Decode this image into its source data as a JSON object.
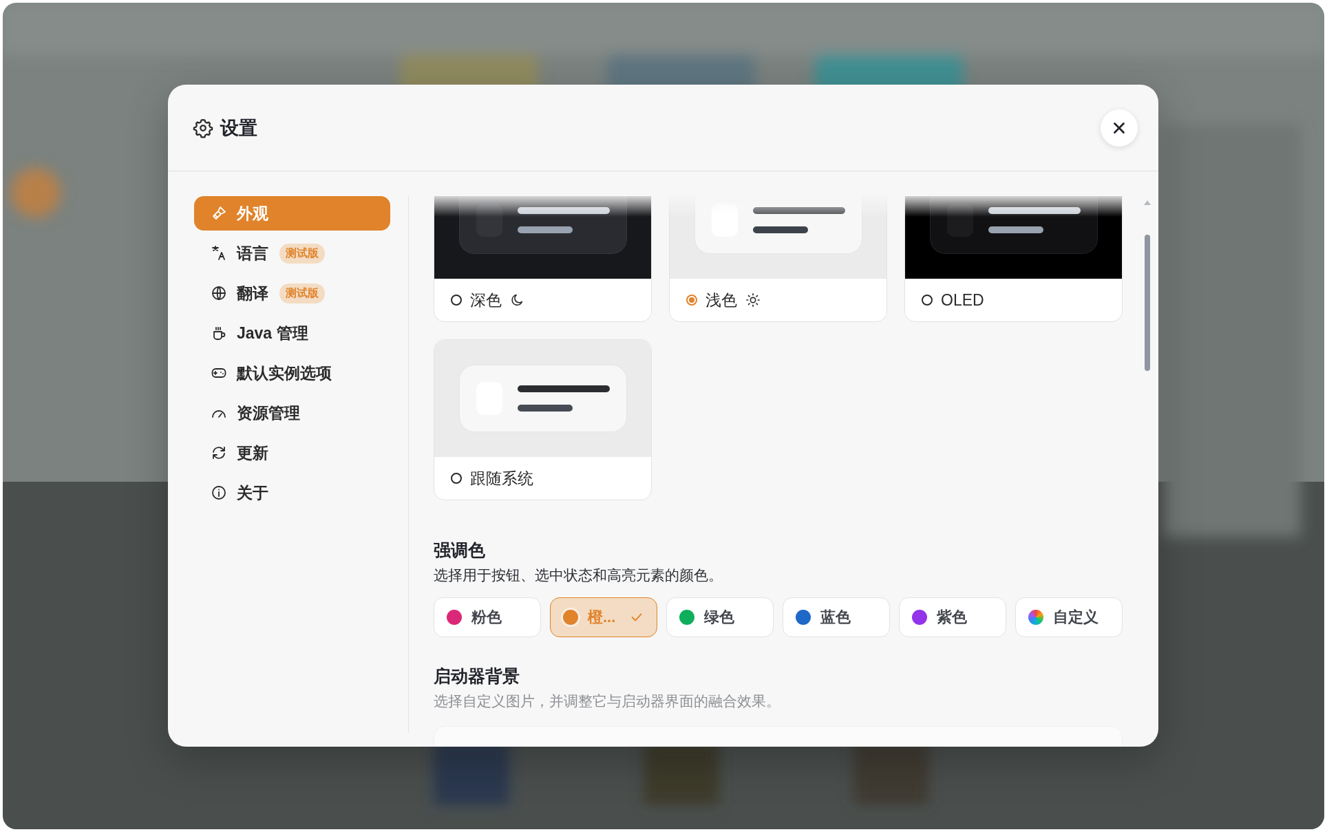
{
  "dialog": {
    "title": "设置"
  },
  "sidebar": {
    "items": [
      {
        "label": "外观",
        "kind": "appearance",
        "selected": true
      },
      {
        "label": "语言",
        "kind": "language",
        "selected": false,
        "badge": "测试版"
      },
      {
        "label": "翻译",
        "kind": "translate",
        "selected": false,
        "badge": "测试版"
      },
      {
        "label": "Java 管理",
        "kind": "java",
        "selected": false
      },
      {
        "label": "默认实例选项",
        "kind": "instance",
        "selected": false
      },
      {
        "label": "资源管理",
        "kind": "resources",
        "selected": false
      },
      {
        "label": "更新",
        "kind": "update",
        "selected": false
      },
      {
        "label": "关于",
        "kind": "about",
        "selected": false
      }
    ]
  },
  "themes": [
    {
      "label": "深色",
      "kind": "dark",
      "selected": false
    },
    {
      "label": "浅色",
      "kind": "light",
      "selected": true
    },
    {
      "label": "OLED",
      "kind": "oled",
      "selected": false
    },
    {
      "label": "跟随系统",
      "kind": "system",
      "selected": false
    }
  ],
  "accent": {
    "title": "强调色",
    "description": "选择用于按钮、选中状态和高亮元素的颜色。",
    "options": [
      {
        "label": "粉色",
        "color": "#db2777",
        "selected": false
      },
      {
        "label": "橙...",
        "color": "#e0832a",
        "selected": true
      },
      {
        "label": "绿色",
        "color": "#0fae5c",
        "selected": false
      },
      {
        "label": "蓝色",
        "color": "#1e68c8",
        "selected": false
      },
      {
        "label": "紫色",
        "color": "#9333ea",
        "selected": false
      },
      {
        "label": "自定义",
        "kind": "custom",
        "selected": false
      }
    ]
  },
  "background": {
    "title": "启动器背景",
    "description": "选择自定义图片，并调整它与启动器界面的融合效果。"
  }
}
